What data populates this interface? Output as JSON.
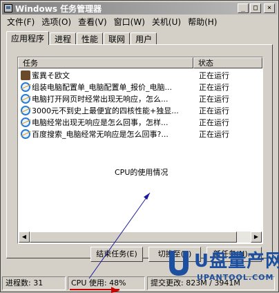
{
  "window": {
    "title": "Windows 任务管理器"
  },
  "titlebar_buttons": {
    "minimize": "_",
    "maximize": "□",
    "close": "×"
  },
  "menu": [
    "文件(F)",
    "选项(O)",
    "查看(V)",
    "窗口(W)",
    "关机(U)",
    "帮助(H)"
  ],
  "tabs": [
    "应用程序",
    "进程",
    "性能",
    "联网",
    "用户"
  ],
  "columns": {
    "task": "任务",
    "status": "状态"
  },
  "tasks": [
    {
      "name": "蜜異そ欧文",
      "status": "正在运行",
      "icon": "folder-icon"
    },
    {
      "name": "组装电脑配置单_电脑配置单_报价_电脑...",
      "status": "正在运行",
      "icon": "ie-icon"
    },
    {
      "name": "电脑打开网页时经常出现无响应，怎么...",
      "status": "正在运行",
      "icon": "ie-icon"
    },
    {
      "name": "3000元不到史上最便宜的四核性能+独显...",
      "status": "正在运行",
      "icon": "ie-icon"
    },
    {
      "name": "电脑经常出现无响应是怎么回事，怎样...",
      "status": "正在运行",
      "icon": "ie-icon"
    },
    {
      "name": "百度搜索_电脑经常无响应是怎么回事?...",
      "status": "正在运行",
      "icon": "ie-icon"
    }
  ],
  "annotation": "CPU的使用情况",
  "buttons": {
    "end_task": "结束任务(E)",
    "switch_to": "切换至(S)",
    "new_task": "新任务(N)..."
  },
  "statusbar": {
    "processes": "进程数: 31",
    "cpu": "CPU 使用: 48%",
    "commit": "提交更改: 823M / 3941M"
  },
  "watermark": {
    "text": "U盘量产网",
    "url": "UPANTOOL.COM"
  },
  "colors": {
    "arrow": "#1a1a9a",
    "underline": "#cc0000",
    "brand": "#1c4fa0"
  }
}
